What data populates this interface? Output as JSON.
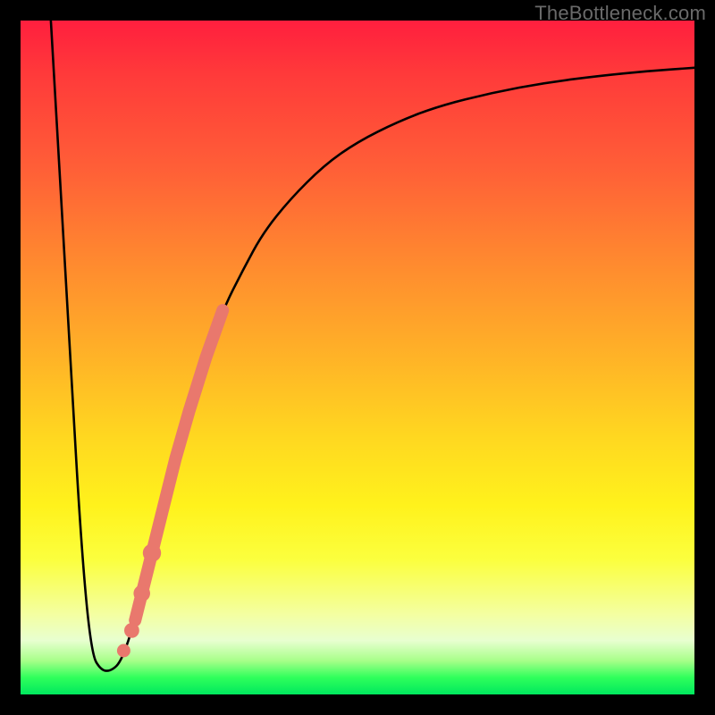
{
  "watermark": "TheBottleneck.com",
  "chart_data": {
    "type": "line",
    "title": "",
    "xlabel": "",
    "ylabel": "",
    "xlim": [
      0,
      100
    ],
    "ylim": [
      0,
      100
    ],
    "series": [
      {
        "name": "curve",
        "x": [
          4.5,
          6.0,
          7.5,
          9.0,
          10.5,
          12.0,
          13.5,
          15.0,
          17.0,
          19.0,
          21.0,
          23.0,
          25.0,
          27.5,
          30.0,
          33.0,
          36.0,
          40.0,
          45.0,
          50.0,
          56.0,
          62.0,
          70.0,
          78.0,
          86.0,
          93.0,
          100.0
        ],
        "values": [
          100,
          74,
          48,
          22,
          6.0,
          3.5,
          3.5,
          5.0,
          11.0,
          19.0,
          27.0,
          35.0,
          42.0,
          50.0,
          57.0,
          63.0,
          68.5,
          73.5,
          78.5,
          82.0,
          85.0,
          87.3,
          89.3,
          90.8,
          91.8,
          92.5,
          93.0
        ]
      }
    ],
    "highlight_segment": {
      "x": [
        17.0,
        19.0,
        21.0,
        23.0,
        25.0,
        27.5,
        30.0
      ],
      "values": [
        11.0,
        19.0,
        27.0,
        35.0,
        42.0,
        50.0,
        57.0
      ]
    },
    "highlight_dots": {
      "x": [
        15.3,
        16.5,
        18.0,
        19.5
      ],
      "values": [
        6.5,
        9.5,
        15.0,
        21.0
      ]
    },
    "colors": {
      "curve": "#000000",
      "highlight": "#e9786d"
    }
  }
}
